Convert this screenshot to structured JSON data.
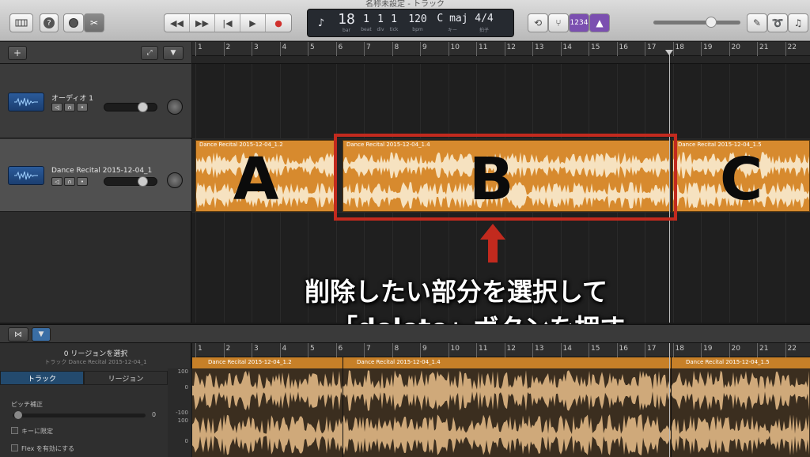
{
  "window": {
    "title": "名称未設定 - トラック"
  },
  "toolbar": {
    "lcd": {
      "bar": "18",
      "beat": "1",
      "div": "1",
      "tick": "1",
      "bar_label": "bar",
      "beat_label": "beat",
      "div_label": "div",
      "tick_label": "tick",
      "tempo": "120",
      "tempo_label": "bpm",
      "key": "C maj",
      "key_label": "キー",
      "sig": "4/4",
      "sig_label": "拍子"
    },
    "count_in_label": "1234"
  },
  "tracks_header": {
    "add_label": "+",
    "tracks": [
      {
        "name": "オーディオ 1"
      },
      {
        "name": "Dance Recital 2015-12-04_1"
      }
    ]
  },
  "arrange": {
    "ruler_ticks": [
      "1",
      "2",
      "3",
      "4",
      "5",
      "6",
      "7",
      "8",
      "9",
      "10",
      "11",
      "12",
      "13",
      "14",
      "15",
      "16",
      "17",
      "18",
      "19",
      "20",
      "21",
      "22"
    ],
    "regions": [
      {
        "title": "Dance Recital 2015-12-04_1.2"
      },
      {
        "title": "Dance Recital 2015-12-04_1.4"
      },
      {
        "title": "Dance Recital 2015-12-04_1.5"
      }
    ]
  },
  "annotation": {
    "letter_a": "A",
    "letter_b": "B",
    "letter_c": "C",
    "caption_line1": "削除したい部分を選択して",
    "caption_line2": "「delete」ボタンを押す",
    "box_color": "#c22a1e"
  },
  "editor": {
    "title": "0 リージョンを選択",
    "subtitle": "トラック Dance Recital 2015-12-04_1",
    "tabs": [
      "トラック",
      "リージョン"
    ],
    "pitch_label": "ピッチ補正",
    "pitch_value": "0",
    "key_limit_label": "キーに限定",
    "flex_label": "Flex を有効にする",
    "scale_labels": [
      "100",
      "0",
      "-100",
      "100",
      "0"
    ],
    "regions": [
      {
        "title": "Dance Recital 2015-12-04_1.2"
      },
      {
        "title": "Dance Recital 2015-12-04_1.4"
      },
      {
        "title": "Dance Recital 2015-12-04_1.5"
      }
    ]
  },
  "colors": {
    "region": "#d78a2e",
    "accent": "#7b4fb0",
    "selection": "#c22a1e"
  }
}
